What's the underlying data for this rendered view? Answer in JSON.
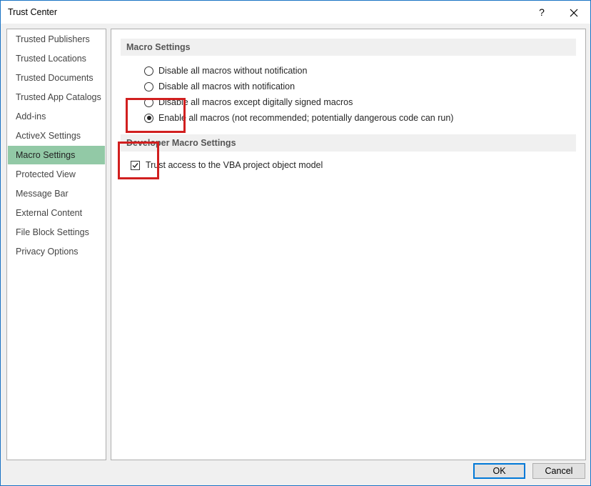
{
  "window": {
    "title": "Trust Center",
    "help_label": "?"
  },
  "sidebar": {
    "items": [
      {
        "label": "Trusted Publishers"
      },
      {
        "label": "Trusted Locations"
      },
      {
        "label": "Trusted Documents"
      },
      {
        "label": "Trusted App Catalogs"
      },
      {
        "label": "Add-ins"
      },
      {
        "label": "ActiveX Settings"
      },
      {
        "label": "Macro Settings",
        "active": true
      },
      {
        "label": "Protected View"
      },
      {
        "label": "Message Bar"
      },
      {
        "label": "External Content"
      },
      {
        "label": "File Block Settings"
      },
      {
        "label": "Privacy Options"
      }
    ]
  },
  "macro_settings": {
    "header": "Macro Settings",
    "options": [
      {
        "label": "Disable all macros without notification",
        "checked": false
      },
      {
        "label": "Disable all macros with notification",
        "checked": false
      },
      {
        "label": "Disable all macros except digitally signed macros",
        "checked": false
      },
      {
        "label": "Enable all macros (not recommended; potentially dangerous code can run)",
        "checked": true
      }
    ]
  },
  "developer_settings": {
    "header": "Developer Macro Settings",
    "trust_vba_label": "Trust access to the VBA project object model",
    "trust_vba_checked": true
  },
  "footer": {
    "ok_label": "OK",
    "cancel_label": "Cancel"
  },
  "colors": {
    "active_nav": "#92c9a6",
    "highlight": "#d11f1f",
    "default_button_border": "#0078d7"
  }
}
